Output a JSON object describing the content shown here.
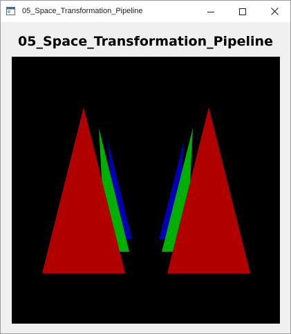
{
  "window": {
    "title": "05_Space_Transformation_Pipeline"
  },
  "content": {
    "heading": "05_Space_Transformation_Pipeline"
  },
  "render": {
    "background": "#000000",
    "colors": {
      "red": "#b00000",
      "green": "#00b000",
      "blue": "#0000b0"
    }
  }
}
